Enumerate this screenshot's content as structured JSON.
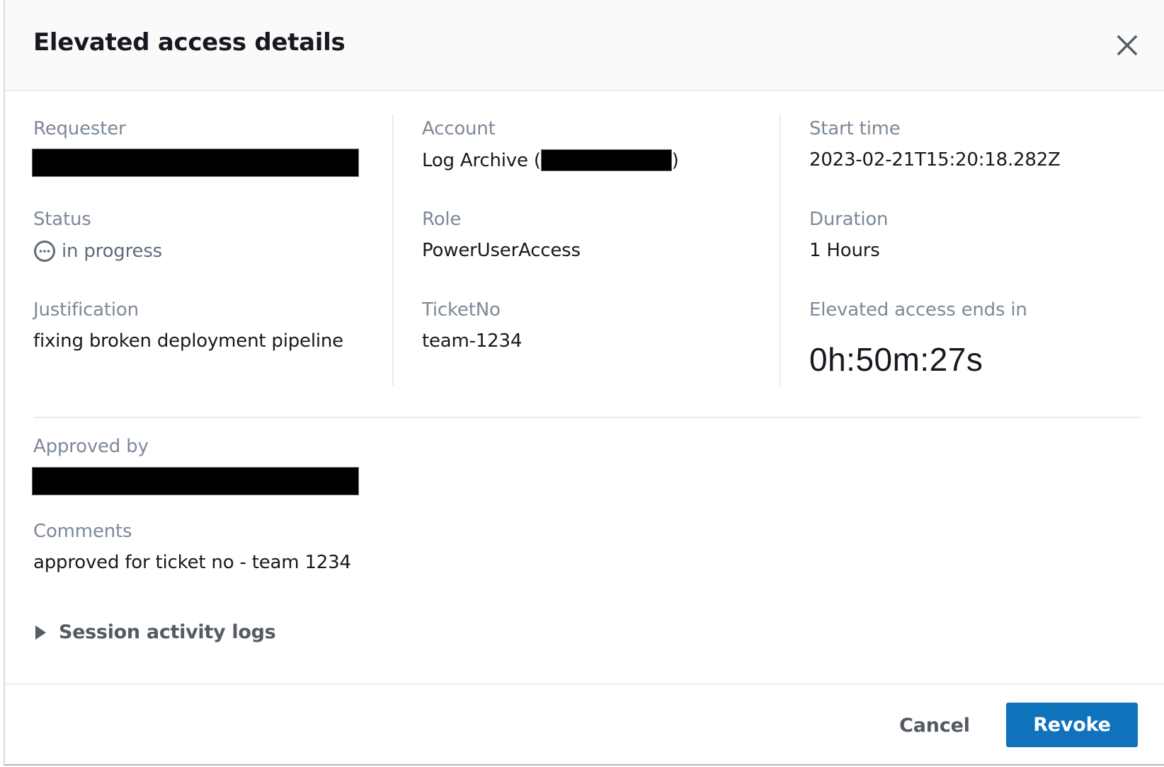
{
  "modal": {
    "title": "Elevated access details",
    "close_icon": "close-icon"
  },
  "details": {
    "requester": {
      "label": "Requester",
      "value": "[redacted]"
    },
    "status": {
      "label": "Status",
      "value": "in progress",
      "icon": "status-in-progress-icon"
    },
    "justification": {
      "label": "Justification",
      "value": "fixing broken deployment pipeline"
    },
    "account": {
      "label": "Account",
      "value_prefix": "Log Archive (",
      "value_redacted": "[redacted]",
      "value_suffix": ")"
    },
    "role": {
      "label": "Role",
      "value": "PowerUserAccess"
    },
    "ticket": {
      "label": "TicketNo",
      "value": "team-1234"
    },
    "start_time": {
      "label": "Start time",
      "value": "2023-02-21T15:20:18.282Z"
    },
    "duration": {
      "label": "Duration",
      "value": "1 Hours"
    },
    "ends_in": {
      "label": "Elevated access ends in",
      "value": "0h:50m:27s"
    }
  },
  "approval": {
    "approved_by": {
      "label": "Approved by",
      "value": "[redacted]"
    },
    "comments": {
      "label": "Comments",
      "value": "approved for ticket no - team 1234"
    }
  },
  "session_logs": {
    "label": "Session activity logs",
    "expanded": false,
    "icon": "caret-right-icon"
  },
  "footer": {
    "cancel_label": "Cancel",
    "revoke_label": "Revoke"
  },
  "colors": {
    "primary_button": "#0f73bc",
    "label_text": "#7d8998",
    "value_text": "#16191f",
    "header_bg": "#fafafa"
  }
}
